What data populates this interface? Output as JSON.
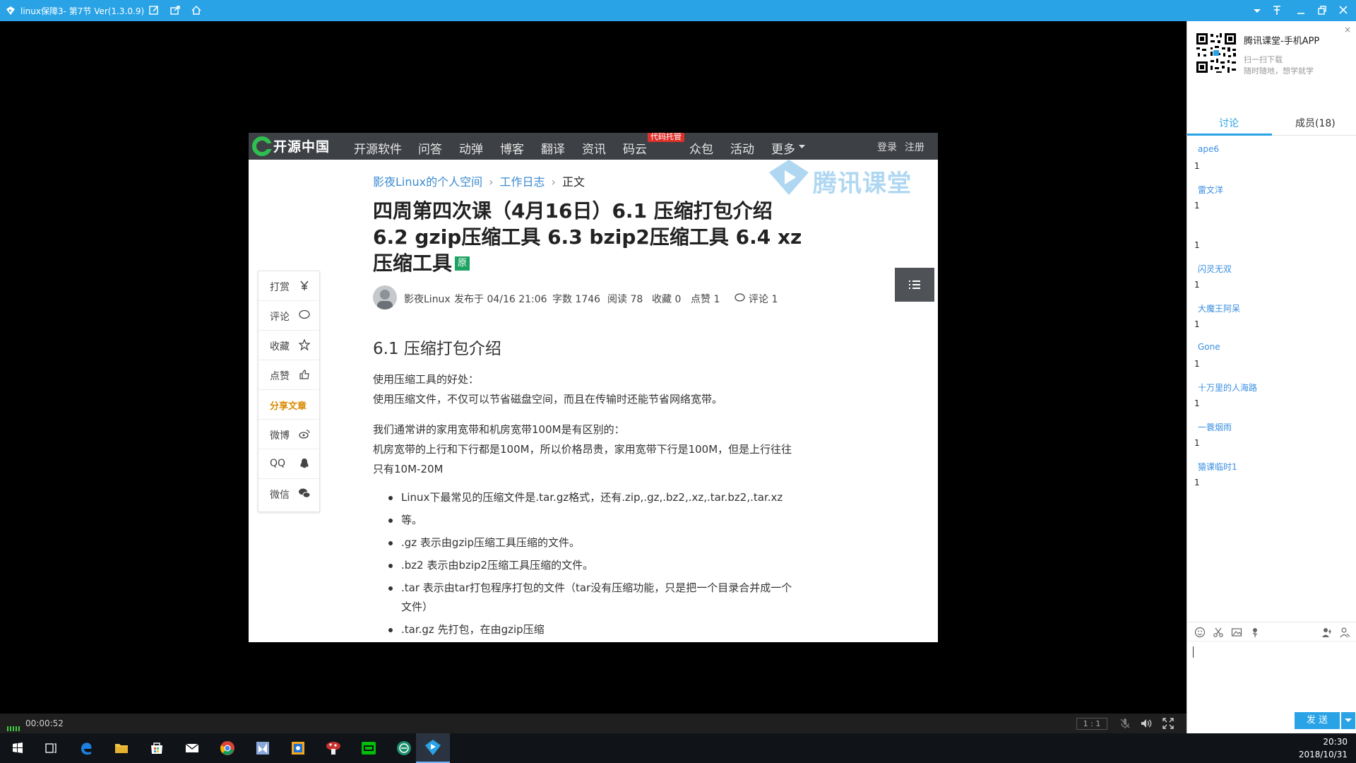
{
  "window": {
    "title": "linux保障3- 第7节 Ver(1.3.0.9)",
    "accent": "#29a3e6"
  },
  "site": {
    "brand": "开源中国",
    "nav": [
      "开源软件",
      "问答",
      "动弹",
      "博客",
      "翻译",
      "资讯",
      "码云",
      "众包",
      "活动",
      "更多"
    ],
    "badge": "代码托管",
    "login": "登录",
    "register": "注册"
  },
  "watermark": "腾讯课堂",
  "article": {
    "breadcrumb": [
      "影夜Linux的个人空间",
      "工作日志",
      "正文"
    ],
    "title": "四周第四次课（4月16日）6.1 压缩打包介绍 6.2 gzip压缩工具 6.3 bzip2压缩工具 6.4 xz压缩工具",
    "original_tag": "原",
    "author": "影夜Linux",
    "published": "发布于 04/16 21:06",
    "words": "字数 1746",
    "reads": "阅读 78",
    "favorites": "收藏 0",
    "likes": "点赞 1",
    "comments": "评论 1",
    "section": "6.1 压缩打包介绍",
    "para1_line1": "使用压缩工具的好处：",
    "para1_line2": "使用压缩文件，不仅可以节省磁盘空间，而且在传输时还能节省网络宽带。",
    "para2_line1": "我们通常讲的家用宽带和机房宽带100M是有区别的：",
    "para2_line2": "机房宽带的上行和下行都是100M，所以价格昂贵，家用宽带下行是100M，但是上行往往只有10M-20M",
    "bullets": [
      "Linux下最常见的压缩文件是.tar.gz格式，还有.zip,.gz,.bz2,.xz,.tar.bz2,.tar.xz",
      "等。",
      ".gz 表示由gzip压缩工具压缩的文件。",
      ".bz2 表示由bzip2压缩工具压缩的文件。",
      ".tar 表示由tar打包程序打包的文件（tar没有压缩功能，只是把一个目录合并成一个文件）",
      ".tar.gz 先打包，在由gzip压缩"
    ]
  },
  "share_panel": [
    "打赏",
    "评论",
    "收藏",
    "点赞",
    "分享文章",
    "微博",
    "QQ",
    "微信"
  ],
  "status": {
    "elapsed": "00:00:52",
    "ratio": "1 : 1"
  },
  "right_panel": {
    "ad_title": "腾讯课堂-手机APP",
    "ad_line1": "扫一扫下载",
    "ad_line2": "随时随地，想学就学",
    "close": "×",
    "tab_discuss": "讨论",
    "tab_members": "成员(18)",
    "messages": [
      {
        "user": "ape6",
        "text": "1"
      },
      {
        "user": "雷文洋",
        "text": "1"
      },
      {
        "user": "",
        "text": "1"
      },
      {
        "user": "闪灵无双",
        "text": "1"
      },
      {
        "user": "大魔王阿呆",
        "text": "1"
      },
      {
        "user": "Gone",
        "text": "1"
      },
      {
        "user": "十万里的人海路",
        "text": "1"
      },
      {
        "user": "一蓑烟雨",
        "text": "1"
      },
      {
        "user": "猿课临时1",
        "text": "1"
      }
    ],
    "send": "发 送"
  },
  "taskbar": {
    "time": "20:30",
    "date": "2018/10/31"
  }
}
